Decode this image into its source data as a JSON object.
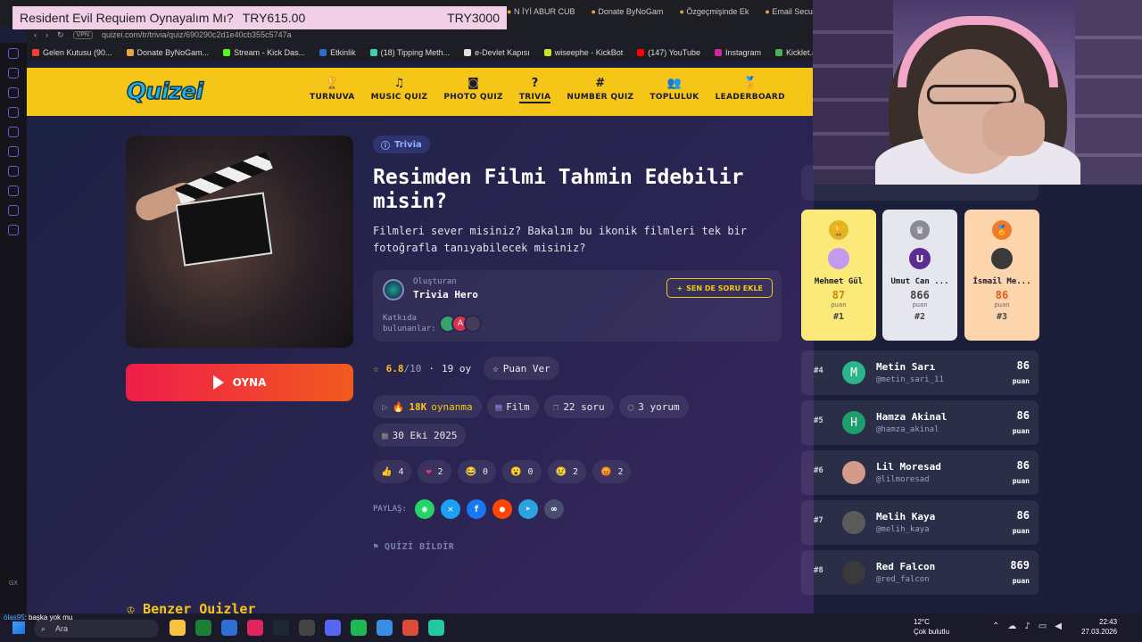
{
  "browser": {
    "stream_overlay": {
      "title": "Resident Evil Requiem Oynayalım Mı?",
      "price_left": "TRY615.00",
      "price_right": "TRY3000"
    },
    "tabs_right": [
      "N İYİ ABUR CUB",
      "Donate ByNoGam",
      "Özgeçmişinde Ek",
      "Email Secure"
    ],
    "vpn": "VPN",
    "url": "quizei.com/tr/trivia/quiz/690290c2d1e40cb355c5747a",
    "bookmarks": [
      "Gelen Kutusu (90...",
      "Donate ByNoGam...",
      "Stream - Kick Das...",
      "Etkinlik",
      "(18) Tipping Meth...",
      "e-Devlet Kapısı",
      "wiseephe - KickBot",
      "(147) YouTube",
      "Instagram",
      "Kicklet.app - Kick..."
    ]
  },
  "site": {
    "logo": "Quizei",
    "nav": [
      {
        "label": "TURNUVA",
        "icon": "trophy-icon",
        "glyph": "🏆"
      },
      {
        "label": "MUSIC QUIZ",
        "icon": "music-icon",
        "glyph": "♫"
      },
      {
        "label": "PHOTO QUIZ",
        "icon": "camera-icon",
        "glyph": "◙"
      },
      {
        "label": "TRIVIA",
        "icon": "question-icon",
        "glyph": "?"
      },
      {
        "label": "NUMBER QUIZ",
        "icon": "hash-icon",
        "glyph": "#"
      },
      {
        "label": "TOPLULUK",
        "icon": "users-icon",
        "glyph": "👥"
      },
      {
        "label": "LEADERBOARD",
        "icon": "award-icon",
        "glyph": "🏅"
      }
    ]
  },
  "quiz": {
    "category": "Trivia",
    "title": "Resimden Filmi Tahmin Edebilir misin?",
    "description": "Filmleri sever misiniz? Bakalım bu ikonik filmleri tek bir fotoğrafla tanıyabilecek misiniz?",
    "creator_label": "Oluşturan",
    "creator_name": "Trivia Hero",
    "add_question": "SEN DE SORU EKLE",
    "contributors_label": "Katkıda bulunanlar:",
    "play_label": "OYNA",
    "rating": "6.8",
    "rating_max": "/10",
    "votes": "19 oy",
    "rate_label": "Puan Ver",
    "plays_value": "18K",
    "plays_label": "oynanma",
    "genre": "Film",
    "questions": "22 soru",
    "comments": "3 yorum",
    "date": "30 Eki 2025",
    "reactions": [
      {
        "emoji": "👍",
        "count": "4"
      },
      {
        "emoji": "❤",
        "count": "2"
      },
      {
        "emoji": "😂",
        "count": "0"
      },
      {
        "emoji": "😮",
        "count": "0"
      },
      {
        "emoji": "😢",
        "count": "2"
      },
      {
        "emoji": "😡",
        "count": "2"
      }
    ],
    "share_label": "PAYLAŞ:",
    "report_label": "QUİZİ BİLDİR",
    "similar_label": "Benzer Quizler"
  },
  "leaderboard": {
    "podium": [
      {
        "name": "Mehmet Gül",
        "points": "87",
        "initial": "",
        "rank": "#1",
        "pts_label": "puan"
      },
      {
        "name": "Umut Can ...",
        "points": "866",
        "initial": "U",
        "rank": "#2",
        "pts_label": "puan"
      },
      {
        "name": "İsmail Me...",
        "points": "86",
        "initial": "",
        "rank": "#3",
        "pts_label": "puan"
      }
    ],
    "rows": [
      {
        "rank": "#4",
        "name": "Metin Sarı",
        "handle": "@metin_sari_11",
        "points": "86",
        "initial": "M",
        "pts_label": "puan"
      },
      {
        "rank": "#5",
        "name": "Hamza Akinal",
        "handle": "@hamza_akinal",
        "points": "86",
        "initial": "H",
        "pts_label": "puan"
      },
      {
        "rank": "#6",
        "name": "Lil Moresad",
        "handle": "@lilmoresad",
        "points": "86",
        "initial": "",
        "pts_label": "puan"
      },
      {
        "rank": "#7",
        "name": "Melih Kaya",
        "handle": "@melih_kaya",
        "points": "86",
        "initial": "",
        "pts_label": "puan"
      },
      {
        "rank": "#8",
        "name": "Red Falcon",
        "handle": "@red_falcon",
        "points": "869",
        "initial": "",
        "pts_label": "puan"
      }
    ]
  },
  "taskbar": {
    "chat_user": "ólas95",
    "chat_msg": ": başka yok mu",
    "search": "Ara",
    "temp": "12°C",
    "weather": "Çok bulutlu",
    "time": "22:43",
    "date": "27.03.2026"
  }
}
